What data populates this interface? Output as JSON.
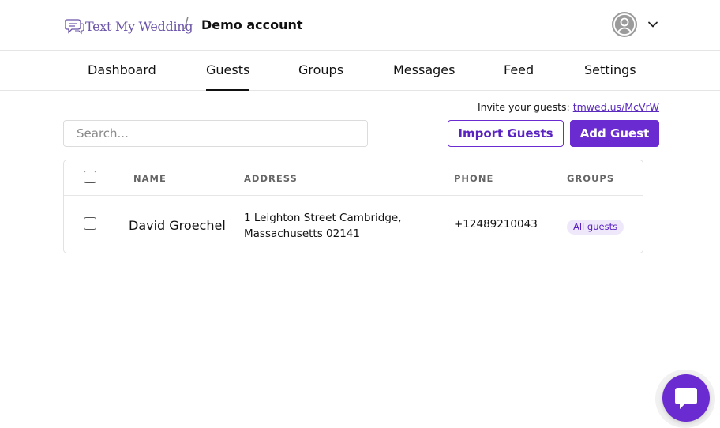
{
  "header": {
    "logo_text": "Text My Wedding",
    "separator": "/",
    "account_name": "Demo account"
  },
  "tabs": [
    {
      "label": "Dashboard",
      "active": false
    },
    {
      "label": "Guests",
      "active": true
    },
    {
      "label": "Groups",
      "active": false
    },
    {
      "label": "Messages",
      "active": false
    },
    {
      "label": "Feed",
      "active": false
    },
    {
      "label": "Settings",
      "active": false
    }
  ],
  "invite": {
    "label": "Invite your guests:",
    "link": "tmwed.us/McVrW"
  },
  "search": {
    "placeholder": "Search...",
    "value": ""
  },
  "actions": {
    "import_label": "Import Guests",
    "add_label": "Add Guest"
  },
  "table": {
    "columns": [
      "NAME",
      "ADDRESS",
      "PHONE",
      "GROUPS"
    ],
    "rows": [
      {
        "name": "David Groechel",
        "address_line1": "1 Leighton Street Cambridge,",
        "address_line2": "Massachusetts 02141",
        "phone": "+12489210043",
        "group": "All guests"
      }
    ]
  },
  "colors": {
    "accent": "#6a2bd0",
    "badge_bg": "#efe8fb",
    "logo": "#6b54a8"
  },
  "icons": {
    "logo": "chat-bubbles-icon",
    "avatar": "user-avatar-icon",
    "menu": "chevron-down-icon",
    "chat": "chat-bubble-icon"
  }
}
